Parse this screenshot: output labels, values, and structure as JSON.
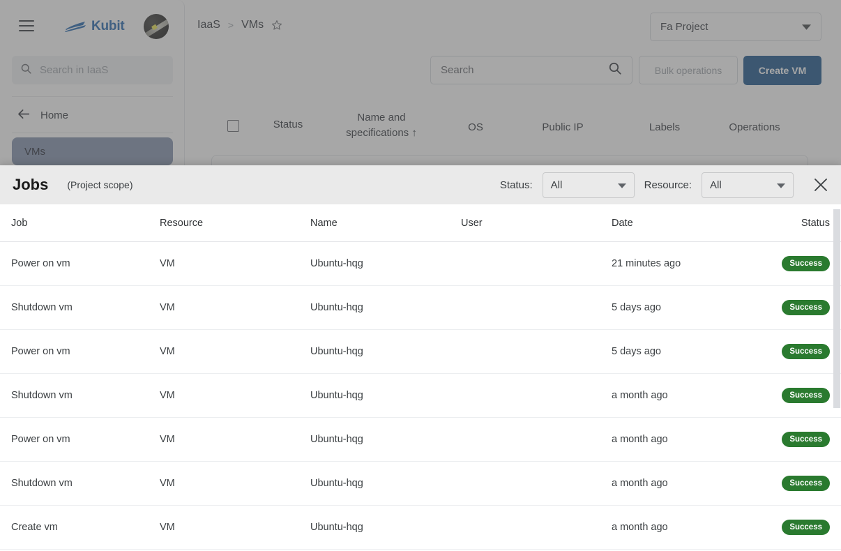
{
  "app": {
    "brand": "Kubit",
    "icons": {
      "hamburger": "hamburger-menu-icon",
      "logo": "boat-logo-icon",
      "avatar": "user-avatar",
      "search": "search-icon",
      "star": "star-outline-icon",
      "back": "arrow-left-icon",
      "chevron": "chevron-down-icon",
      "close": "close-icon"
    },
    "colors": {
      "brand_blue": "#1b63ad",
      "primary_button": "#134f87",
      "success_badge": "#2a7a2f",
      "sidebar_active": "#7f8fab",
      "panel_header": "#eaeaea",
      "redaction": "#7f7f7f"
    }
  },
  "sidebar": {
    "search_placeholder": "Search in IaaS",
    "home_label": "Home",
    "items": [
      {
        "label": "VMs",
        "active": true
      }
    ]
  },
  "header": {
    "breadcrumb": [
      "IaaS",
      "VMs"
    ],
    "separator": ">",
    "project_selector": {
      "value": "Fa Project"
    }
  },
  "toolbar": {
    "search_placeholder": "Search",
    "bulk_operations_label": "Bulk operations",
    "create_vm_label": "Create VM"
  },
  "vm_table": {
    "columns": [
      {
        "label": "Status"
      },
      {
        "label": "Name and specifications ↑"
      },
      {
        "label": "OS"
      },
      {
        "label": "Public IP"
      },
      {
        "label": "Labels"
      },
      {
        "label": "Operations"
      }
    ]
  },
  "jobs_panel": {
    "title": "Jobs",
    "scope": "(Project scope)",
    "filters": [
      {
        "label": "Status:",
        "value": "All"
      },
      {
        "label": "Resource:",
        "value": "All"
      }
    ],
    "columns": [
      "Job",
      "Resource",
      "Name",
      "User",
      "Date",
      "Status"
    ],
    "rows": [
      {
        "job": "Power on vm",
        "resource": "VM",
        "name": "Ubuntu-hqg",
        "user": "",
        "date": "21 minutes ago",
        "status": "Success"
      },
      {
        "job": "Shutdown vm",
        "resource": "VM",
        "name": "Ubuntu-hqg",
        "user": "",
        "date": "5 days ago",
        "status": "Success"
      },
      {
        "job": "Power on vm",
        "resource": "VM",
        "name": "Ubuntu-hqg",
        "user": "",
        "date": "5 days ago",
        "status": "Success"
      },
      {
        "job": "Shutdown vm",
        "resource": "VM",
        "name": "Ubuntu-hqg",
        "user": "",
        "date": "a month ago",
        "status": "Success"
      },
      {
        "job": "Power on vm",
        "resource": "VM",
        "name": "Ubuntu-hqg",
        "user": "",
        "date": "a month ago",
        "status": "Success"
      },
      {
        "job": "Shutdown vm",
        "resource": "VM",
        "name": "Ubuntu-hqg",
        "user": "",
        "date": "a month ago",
        "status": "Success"
      },
      {
        "job": "Create vm",
        "resource": "VM",
        "name": "Ubuntu-hqg",
        "user": "",
        "date": "a month ago",
        "status": "Success"
      }
    ]
  }
}
